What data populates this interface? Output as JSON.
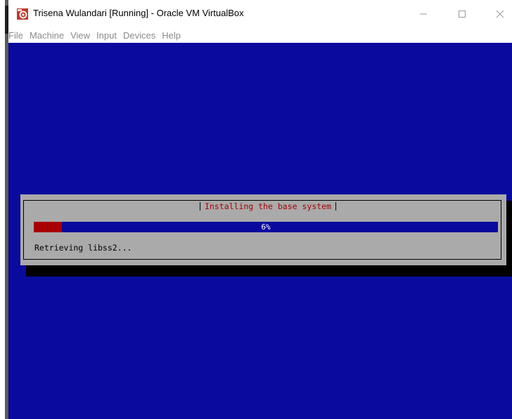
{
  "window": {
    "title": "Trisena Wulandari [Running] - Oracle VM VirtualBox",
    "icon": "virtualbox-app-icon",
    "controls": {
      "minimize": "minimize-icon",
      "maximize": "maximize-icon",
      "close": "close-icon"
    }
  },
  "menubar": {
    "items": [
      {
        "label": "File"
      },
      {
        "label": "Machine"
      },
      {
        "label": "View"
      },
      {
        "label": "Input"
      },
      {
        "label": "Devices"
      },
      {
        "label": "Help"
      }
    ]
  },
  "installer": {
    "dialog_title": "Installing the base system",
    "progress": {
      "percent": 6,
      "label": "6%"
    },
    "status": "Retrieving libss2..."
  },
  "colors": {
    "screen_background": "#0a0a9e",
    "dialog_background": "#aaaaaa",
    "progress_fill": "#a80000",
    "title_text": "#a80000"
  }
}
